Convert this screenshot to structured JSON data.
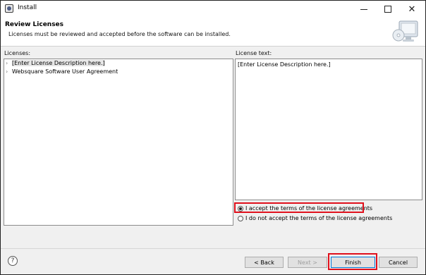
{
  "window": {
    "title": "Install"
  },
  "header": {
    "title": "Review Licenses",
    "description": "Licenses must be reviewed and accepted before the software can be installed."
  },
  "licenses": {
    "label": "Licenses:",
    "items": [
      {
        "label": "[Enter License Description here.]",
        "selected": true
      },
      {
        "label": "Websquare Software User Agreement",
        "selected": false
      }
    ]
  },
  "license_text": {
    "label": "License text:",
    "content": "[Enter License Description here.]"
  },
  "options": {
    "accept": "I accept the terms of the license agreements",
    "decline": "I do not accept the terms of the license agreements",
    "selected": "accept"
  },
  "buttons": {
    "help": "?",
    "back": "< Back",
    "next": "Next >",
    "finish": "Finish",
    "cancel": "Cancel"
  },
  "highlight_color": "#e0101c"
}
